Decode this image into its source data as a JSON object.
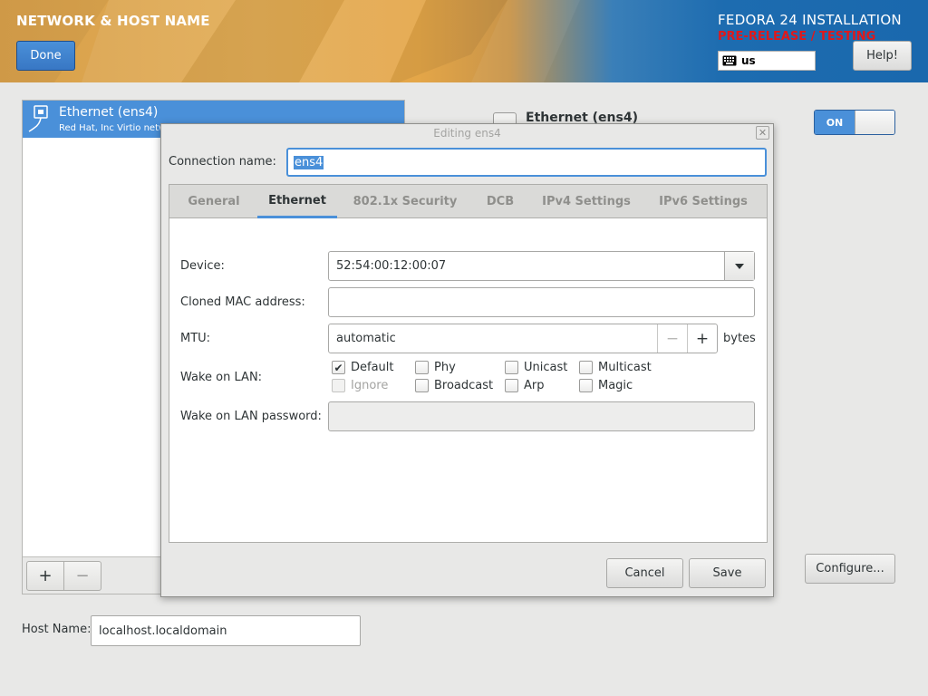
{
  "header": {
    "spoke_title": "NETWORK & HOST NAME",
    "done_label": "Done",
    "distro_title": "FEDORA 24 INSTALLATION",
    "prerelease": "PRE-RELEASE / TESTING",
    "keyboard_layout": "us",
    "help_label": "Help!",
    "prerelease_color": "#e0181b"
  },
  "device_list": {
    "items": [
      {
        "name": "Ethernet (ens4)",
        "description": "Red Hat, Inc Virtio network device",
        "icon": "network-wired-icon",
        "selected": true
      }
    ],
    "add_label": "+",
    "remove_label": "−"
  },
  "device_panel": {
    "title": "Ethernet (ens4)",
    "toggle_label": "ON",
    "configure_label": "Configure..."
  },
  "hostname": {
    "label": "Host Name:",
    "value": "localhost.localdomain"
  },
  "dialog": {
    "title": "Editing ens4",
    "connection_name_label": "Connection name:",
    "connection_name_value": "ens4",
    "tabs": [
      {
        "label": "General"
      },
      {
        "label": "Ethernet"
      },
      {
        "label": "802.1x Security"
      },
      {
        "label": "DCB"
      },
      {
        "label": "IPv4 Settings"
      },
      {
        "label": "IPv6 Settings"
      }
    ],
    "active_tab": "Ethernet",
    "ethernet": {
      "device_label": "Device:",
      "device_value": "52:54:00:12:00:07",
      "cloned_mac_label": "Cloned MAC address:",
      "cloned_mac_value": "",
      "mtu_label": "MTU:",
      "mtu_value": "automatic",
      "mtu_minus": "−",
      "mtu_plus": "+",
      "mtu_unit": "bytes",
      "wol_label": "Wake on LAN:",
      "wol_options": [
        {
          "label": "Default",
          "checked": true,
          "enabled": true
        },
        {
          "label": "Phy",
          "checked": false,
          "enabled": true
        },
        {
          "label": "Unicast",
          "checked": false,
          "enabled": true
        },
        {
          "label": "Multicast",
          "checked": false,
          "enabled": true
        },
        {
          "label": "Ignore",
          "checked": false,
          "enabled": false
        },
        {
          "label": "Broadcast",
          "checked": false,
          "enabled": true
        },
        {
          "label": "Arp",
          "checked": false,
          "enabled": true
        },
        {
          "label": "Magic",
          "checked": false,
          "enabled": true
        }
      ],
      "wol_password_label": "Wake on LAN password:",
      "wol_password_value": ""
    },
    "cancel_label": "Cancel",
    "save_label": "Save"
  },
  "accent_color": "#4a90d9"
}
